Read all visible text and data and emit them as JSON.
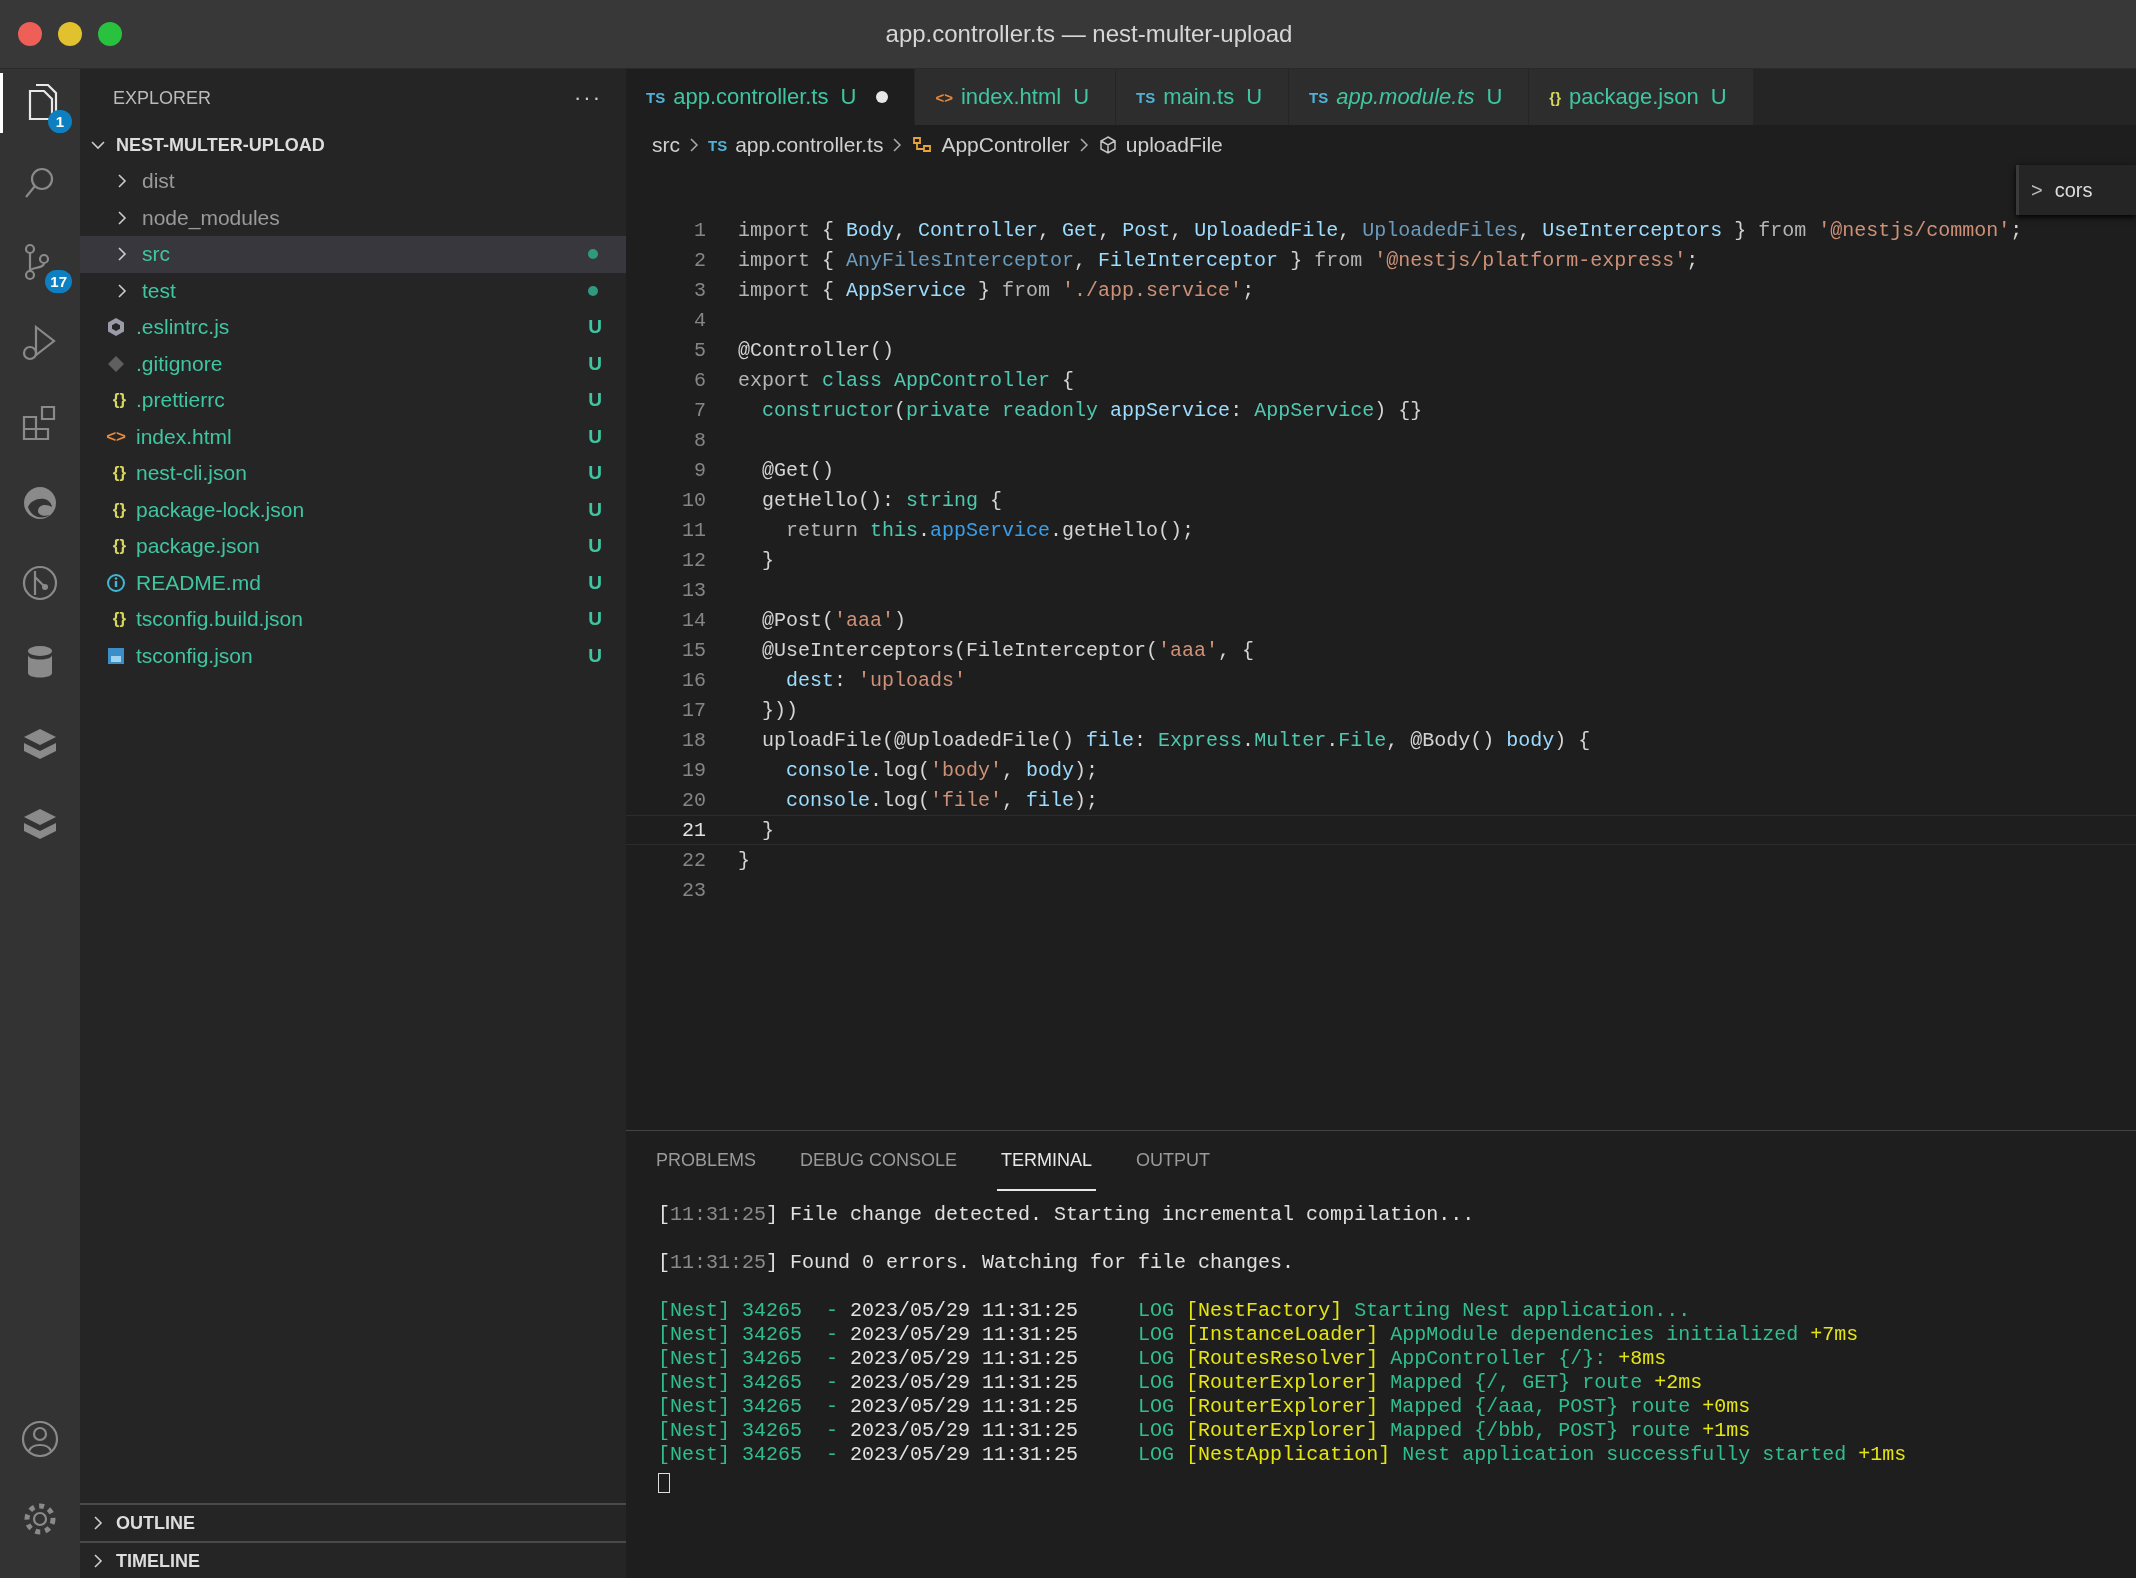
{
  "window": {
    "title": "app.controller.ts — nest-multer-upload"
  },
  "activity_bar": {
    "items": [
      {
        "badge": "1",
        "selected": true
      },
      {
        "selected": false
      },
      {
        "badge": "17",
        "selected": false
      },
      {
        "selected": false
      },
      {
        "selected": false
      },
      {
        "selected": false
      },
      {
        "selected": false
      },
      {
        "selected": false
      },
      {
        "selected": false
      },
      {
        "selected": false
      }
    ]
  },
  "sidebar": {
    "title": "EXPLORER",
    "more": "···",
    "project": {
      "name": "NEST-MULTER-UPLOAD",
      "expanded": true
    },
    "items": [
      {
        "kind": "folder",
        "name": "dist",
        "expanded": false,
        "ignored": true,
        "modified": false,
        "selected": false
      },
      {
        "kind": "folder",
        "name": "node_modules",
        "expanded": false,
        "ignored": true,
        "modified": false,
        "selected": false
      },
      {
        "kind": "folder",
        "name": "src",
        "expanded": false,
        "ignored": false,
        "modified": true,
        "selected": true
      },
      {
        "kind": "folder",
        "name": "test",
        "expanded": false,
        "ignored": false,
        "modified": true,
        "selected": false
      },
      {
        "kind": "eslint",
        "name": ".eslintrc.js",
        "status": "U",
        "selected": false
      },
      {
        "kind": "git",
        "name": ".gitignore",
        "status": "U",
        "selected": false
      },
      {
        "kind": "json",
        "glyph": "{}",
        "name": ".prettierrc",
        "status": "U",
        "selected": false
      },
      {
        "kind": "html",
        "glyph": "<>",
        "name": "index.html",
        "status": "U",
        "selected": false
      },
      {
        "kind": "json",
        "glyph": "{}",
        "name": "nest-cli.json",
        "status": "U",
        "selected": false
      },
      {
        "kind": "json",
        "glyph": "{}",
        "name": "package-lock.json",
        "status": "U",
        "selected": false
      },
      {
        "kind": "json",
        "glyph": "{}",
        "name": "package.json",
        "status": "U",
        "selected": false
      },
      {
        "kind": "info",
        "name": "README.md",
        "status": "U",
        "selected": false
      },
      {
        "kind": "json",
        "glyph": "{}",
        "name": "tsconfig.build.json",
        "status": "U",
        "selected": false
      },
      {
        "kind": "tsconfig",
        "name": "tsconfig.json",
        "status": "U",
        "selected": false
      }
    ],
    "sections": [
      {
        "title": "OUTLINE",
        "expanded": false
      },
      {
        "title": "TIMELINE",
        "expanded": false
      }
    ]
  },
  "tabs": [
    {
      "glyph": "TS",
      "kind": "ts",
      "label": "app.controller.ts",
      "status": "U",
      "selected": true,
      "dirty": true,
      "preview": false
    },
    {
      "glyph": "<>",
      "kind": "html",
      "label": "index.html",
      "status": "U",
      "selected": false,
      "dirty": false,
      "preview": false
    },
    {
      "glyph": "TS",
      "kind": "ts",
      "label": "main.ts",
      "status": "U",
      "selected": false,
      "dirty": false,
      "preview": false
    },
    {
      "glyph": "TS",
      "kind": "ts",
      "label": "app.module.ts",
      "status": "U",
      "selected": false,
      "dirty": false,
      "preview": true
    },
    {
      "glyph": "{}",
      "kind": "json",
      "label": "package.json",
      "status": "U",
      "selected": false,
      "dirty": false,
      "preview": false
    }
  ],
  "breadcrumbs": [
    {
      "label": "src"
    },
    {
      "label": "app.controller.ts",
      "glyph": "TS",
      "kind": "ts"
    },
    {
      "label": "AppController",
      "kind": "class"
    },
    {
      "label": "uploadFile",
      "kind": "method"
    }
  ],
  "find_widget": {
    "chevron": ">",
    "query": "cors"
  },
  "editor": {
    "lines": [
      {
        "number": "1",
        "current": false,
        "tokens": [
          {
            "text": "import ",
            "kind": "kw"
          },
          {
            "text": "{ ",
            "kind": "p"
          },
          {
            "text": "Body",
            "kind": "v"
          },
          {
            "text": ", ",
            "kind": "p"
          },
          {
            "text": "Controller",
            "kind": "v"
          },
          {
            "text": ", ",
            "kind": "p"
          },
          {
            "text": "Get",
            "kind": "v"
          },
          {
            "text": ", ",
            "kind": "p"
          },
          {
            "text": "Post",
            "kind": "v"
          },
          {
            "text": ", ",
            "kind": "p"
          },
          {
            "text": "UploadedFile",
            "kind": "v"
          },
          {
            "text": ", ",
            "kind": "p"
          },
          {
            "text": "UploadedFiles",
            "kind": "dim"
          },
          {
            "text": ", ",
            "kind": "p"
          },
          {
            "text": "UseInterceptors",
            "kind": "v"
          },
          {
            "text": " } ",
            "kind": "p"
          },
          {
            "text": "from ",
            "kind": "kw"
          },
          {
            "text": "'@nestjs/common'",
            "kind": "s"
          },
          {
            "text": ";",
            "kind": "p"
          }
        ]
      },
      {
        "number": "2",
        "current": false,
        "tokens": [
          {
            "text": "import ",
            "kind": "kw"
          },
          {
            "text": "{ ",
            "kind": "p"
          },
          {
            "text": "AnyFilesInterceptor",
            "kind": "dim"
          },
          {
            "text": ", ",
            "kind": "p"
          },
          {
            "text": "FileInterceptor",
            "kind": "v"
          },
          {
            "text": " } ",
            "kind": "p"
          },
          {
            "text": "from ",
            "kind": "kw"
          },
          {
            "text": "'@nestjs/platform-express'",
            "kind": "s"
          },
          {
            "text": ";",
            "kind": "p"
          }
        ]
      },
      {
        "number": "3",
        "current": false,
        "tokens": [
          {
            "text": "import ",
            "kind": "kw"
          },
          {
            "text": "{ ",
            "kind": "p"
          },
          {
            "text": "AppService",
            "kind": "v"
          },
          {
            "text": " } ",
            "kind": "p"
          },
          {
            "text": "from ",
            "kind": "kw"
          },
          {
            "text": "'./app.service'",
            "kind": "s"
          },
          {
            "text": ";",
            "kind": "p"
          }
        ]
      },
      {
        "number": "4",
        "current": false
      },
      {
        "number": "5",
        "current": false,
        "tokens": [
          {
            "text": "@Controller()",
            "kind": "p"
          }
        ]
      },
      {
        "number": "6",
        "current": false,
        "tokens": [
          {
            "text": "export ",
            "kind": "kw"
          },
          {
            "text": "class ",
            "kind": "t"
          },
          {
            "text": "AppController",
            "kind": "t"
          },
          {
            "text": " {",
            "kind": "p"
          }
        ]
      },
      {
        "number": "7",
        "current": false,
        "tokens": [
          {
            "text": "  constructor",
            "kind": "t"
          },
          {
            "text": "(",
            "kind": "p"
          },
          {
            "text": "private readonly ",
            "kind": "t"
          },
          {
            "text": "appService",
            "kind": "v"
          },
          {
            "text": ": ",
            "kind": "p"
          },
          {
            "text": "AppService",
            "kind": "t"
          },
          {
            "text": ") {}",
            "kind": "p"
          }
        ]
      },
      {
        "number": "8",
        "current": false
      },
      {
        "number": "9",
        "current": false,
        "tokens": [
          {
            "text": "  @Get()",
            "kind": "p"
          }
        ]
      },
      {
        "number": "10",
        "current": false,
        "tokens": [
          {
            "text": "  getHello(): ",
            "kind": "p"
          },
          {
            "text": "string",
            "kind": "t"
          },
          {
            "text": " {",
            "kind": "p"
          }
        ]
      },
      {
        "number": "11",
        "current": false,
        "tokens": [
          {
            "text": "    return ",
            "kind": "kw"
          },
          {
            "text": "this",
            "kind": "t"
          },
          {
            "text": ".",
            "kind": "p"
          },
          {
            "text": "appService",
            "kind": "prop"
          },
          {
            "text": ".getHello();",
            "kind": "p"
          }
        ]
      },
      {
        "number": "12",
        "current": false,
        "tokens": [
          {
            "text": "  }",
            "kind": "p"
          }
        ]
      },
      {
        "number": "13",
        "current": false
      },
      {
        "number": "14",
        "current": false,
        "tokens": [
          {
            "text": "  @Post(",
            "kind": "p"
          },
          {
            "text": "'aaa'",
            "kind": "s"
          },
          {
            "text": ")",
            "kind": "p"
          }
        ]
      },
      {
        "number": "15",
        "current": false,
        "tokens": [
          {
            "text": "  @UseInterceptors(FileInterceptor(",
            "kind": "p"
          },
          {
            "text": "'aaa'",
            "kind": "s"
          },
          {
            "text": ", {",
            "kind": "p"
          }
        ]
      },
      {
        "number": "16",
        "current": false,
        "tokens": [
          {
            "text": "    dest",
            "kind": "v"
          },
          {
            "text": ": ",
            "kind": "p"
          },
          {
            "text": "'uploads'",
            "kind": "s"
          }
        ]
      },
      {
        "number": "17",
        "current": false,
        "tokens": [
          {
            "text": "  }))",
            "kind": "p"
          }
        ]
      },
      {
        "number": "18",
        "current": false,
        "tokens": [
          {
            "text": "  uploadFile(@UploadedFile() ",
            "kind": "p"
          },
          {
            "text": "file",
            "kind": "v"
          },
          {
            "text": ": ",
            "kind": "p"
          },
          {
            "text": "Express",
            "kind": "t"
          },
          {
            "text": ".",
            "kind": "p"
          },
          {
            "text": "Multer",
            "kind": "t"
          },
          {
            "text": ".",
            "kind": "p"
          },
          {
            "text": "File",
            "kind": "t"
          },
          {
            "text": ", @Body() ",
            "kind": "p"
          },
          {
            "text": "body",
            "kind": "v"
          },
          {
            "text": ") {",
            "kind": "p"
          }
        ]
      },
      {
        "number": "19",
        "current": false,
        "tokens": [
          {
            "text": "    console",
            "kind": "v"
          },
          {
            "text": ".log(",
            "kind": "p"
          },
          {
            "text": "'body'",
            "kind": "s"
          },
          {
            "text": ", ",
            "kind": "p"
          },
          {
            "text": "body",
            "kind": "v"
          },
          {
            "text": ");",
            "kind": "p"
          }
        ]
      },
      {
        "number": "20",
        "current": false,
        "tokens": [
          {
            "text": "    console",
            "kind": "v"
          },
          {
            "text": ".log(",
            "kind": "p"
          },
          {
            "text": "'file'",
            "kind": "s"
          },
          {
            "text": ", ",
            "kind": "p"
          },
          {
            "text": "file",
            "kind": "v"
          },
          {
            "text": ");",
            "kind": "p"
          }
        ]
      },
      {
        "number": "21",
        "current": true,
        "tokens": [
          {
            "text": "  }",
            "kind": "p"
          }
        ]
      },
      {
        "number": "22",
        "current": false,
        "tokens": [
          {
            "text": "}",
            "kind": "p"
          }
        ]
      },
      {
        "number": "23",
        "current": false
      }
    ]
  },
  "panel": {
    "tabs": [
      {
        "label": "PROBLEMS",
        "selected": false
      },
      {
        "label": "DEBUG CONSOLE",
        "selected": false
      },
      {
        "label": "TERMINAL",
        "selected": true
      },
      {
        "label": "OUTPUT",
        "selected": false
      }
    ],
    "terminal": [
      {
        "gap": false,
        "segments": [
          {
            "text": "[",
            "kind": "w"
          },
          {
            "text": "11:31:25",
            "kind": "d"
          },
          {
            "text": "] File change detected. Starting incremental compilation...",
            "kind": "w"
          }
        ]
      },
      {
        "gap": true,
        "segments": [
          {
            "text": "[",
            "kind": "w"
          },
          {
            "text": "11:31:25",
            "kind": "d"
          },
          {
            "text": "] Found 0 errors. Watching for file changes.",
            "kind": "w"
          }
        ]
      },
      {
        "gap": true,
        "segments": [
          {
            "text": "[Nest] 34265  - ",
            "kind": "g"
          },
          {
            "text": "2023/05/29 11:31:25",
            "kind": "w"
          },
          {
            "text": "     LOG ",
            "kind": "g"
          },
          {
            "text": "[NestFactory]",
            "kind": "y"
          },
          {
            "text": " Starting Nest application...",
            "kind": "g"
          }
        ]
      },
      {
        "gap": false,
        "segments": [
          {
            "text": "[Nest] 34265  - ",
            "kind": "g"
          },
          {
            "text": "2023/05/29 11:31:25",
            "kind": "w"
          },
          {
            "text": "     LOG ",
            "kind": "g"
          },
          {
            "text": "[InstanceLoader]",
            "kind": "y"
          },
          {
            "text": " AppModule dependencies initialized",
            "kind": "g"
          },
          {
            "text": " +7ms",
            "kind": "y"
          }
        ]
      },
      {
        "gap": false,
        "segments": [
          {
            "text": "[Nest] 34265  - ",
            "kind": "g"
          },
          {
            "text": "2023/05/29 11:31:25",
            "kind": "w"
          },
          {
            "text": "     LOG ",
            "kind": "g"
          },
          {
            "text": "[RoutesResolver]",
            "kind": "y"
          },
          {
            "text": " AppController {/}:",
            "kind": "g"
          },
          {
            "text": " +8ms",
            "kind": "y"
          }
        ]
      },
      {
        "gap": false,
        "segments": [
          {
            "text": "[Nest] 34265  - ",
            "kind": "g"
          },
          {
            "text": "2023/05/29 11:31:25",
            "kind": "w"
          },
          {
            "text": "     LOG ",
            "kind": "g"
          },
          {
            "text": "[RouterExplorer]",
            "kind": "y"
          },
          {
            "text": " Mapped {/, GET} route",
            "kind": "g"
          },
          {
            "text": " +2ms",
            "kind": "y"
          }
        ]
      },
      {
        "gap": false,
        "segments": [
          {
            "text": "[Nest] 34265  - ",
            "kind": "g"
          },
          {
            "text": "2023/05/29 11:31:25",
            "kind": "w"
          },
          {
            "text": "     LOG ",
            "kind": "g"
          },
          {
            "text": "[RouterExplorer]",
            "kind": "y"
          },
          {
            "text": " Mapped {/aaa, POST} route",
            "kind": "g"
          },
          {
            "text": " +0ms",
            "kind": "y"
          }
        ]
      },
      {
        "gap": false,
        "segments": [
          {
            "text": "[Nest] 34265  - ",
            "kind": "g"
          },
          {
            "text": "2023/05/29 11:31:25",
            "kind": "w"
          },
          {
            "text": "     LOG ",
            "kind": "g"
          },
          {
            "text": "[RouterExplorer]",
            "kind": "y"
          },
          {
            "text": " Mapped {/bbb, POST} route",
            "kind": "g"
          },
          {
            "text": " +1ms",
            "kind": "y"
          }
        ]
      },
      {
        "gap": false,
        "segments": [
          {
            "text": "[Nest] 34265  - ",
            "kind": "g"
          },
          {
            "text": "2023/05/29 11:31:25",
            "kind": "w"
          },
          {
            "text": "     LOG ",
            "kind": "g"
          },
          {
            "text": "[NestApplication]",
            "kind": "y"
          },
          {
            "text": " Nest application successfully started",
            "kind": "g"
          },
          {
            "text": " +1ms",
            "kind": "y"
          }
        ]
      }
    ]
  }
}
